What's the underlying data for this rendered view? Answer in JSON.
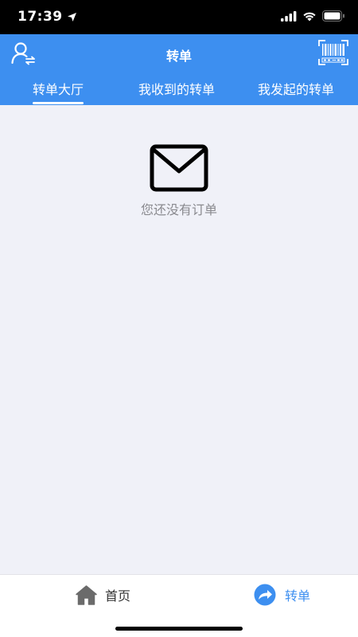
{
  "status_bar": {
    "time": "17:39"
  },
  "header": {
    "title": "转单"
  },
  "tabs": [
    {
      "label": "转单大厅",
      "active": true
    },
    {
      "label": "我收到的转单",
      "active": false
    },
    {
      "label": "我发起的转单",
      "active": false
    }
  ],
  "empty_state": {
    "message": "您还没有订单"
  },
  "tabbar": {
    "items": [
      {
        "label": "首页",
        "active": false
      },
      {
        "label": "转单",
        "active": true
      }
    ]
  },
  "colors": {
    "primary": "#3d8ff0",
    "background": "#f0f1f8",
    "muted_text": "#8a8a8f",
    "inactive_tab": "#333333"
  }
}
